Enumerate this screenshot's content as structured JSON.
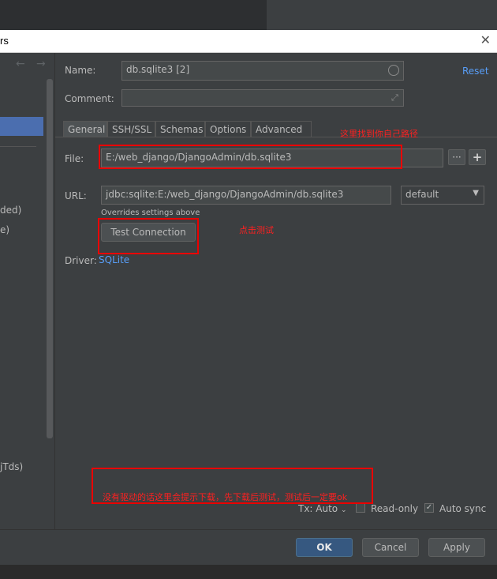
{
  "window": {
    "title_fragment": "rs",
    "close_glyph": "✕"
  },
  "left_panel": {
    "fragments": [
      "ded)",
      "e)",
      "jTds)"
    ]
  },
  "form": {
    "name_label": "Name:",
    "name_value": "db.sqlite3 [2]",
    "reset_label": "Reset",
    "comment_label": "Comment:",
    "comment_value": "",
    "tabs": [
      "General",
      "SSH/SSL",
      "Schemas",
      "Options",
      "Advanced"
    ],
    "active_tab": "General",
    "file_label": "File:",
    "file_value": "E:/web_django/DjangoAdmin/db.sqlite3",
    "url_label": "URL:",
    "url_value": "jdbc:sqlite:E:/web_django/DjangoAdmin/db.sqlite3",
    "url_mode": "default",
    "overrides_note": "Overrides settings above",
    "test_connection_label": "Test Connection",
    "driver_label": "Driver:",
    "driver_value": "SQLite",
    "tx_label": "Tx: Auto",
    "readonly_label": "Read-only",
    "readonly_checked": false,
    "autosync_label": "Auto sync",
    "autosync_checked": true
  },
  "annotations": {
    "file_note": "这里找到你自己路径",
    "test_note": "点击测试",
    "driver_note": "没有驱动的话这里会提示下载，先下载后测试，测试后一定要ok"
  },
  "buttons": {
    "ok": "OK",
    "cancel": "Cancel",
    "apply": "Apply"
  },
  "colors": {
    "accent": "#589df6",
    "annotation": "#ea0000",
    "primary_button": "#365880"
  }
}
